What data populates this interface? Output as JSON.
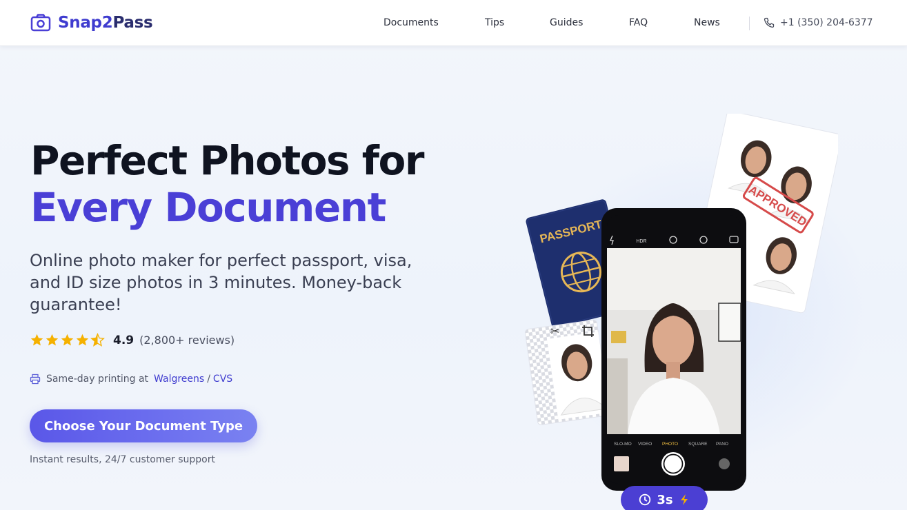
{
  "header": {
    "logo_text_a": "Snap2",
    "logo_text_b": "Pass",
    "logo_icon": "camera-icon",
    "nav": [
      "Documents",
      "Tips",
      "Guides",
      "FAQ",
      "News"
    ],
    "phone": "+1 (350) 204-6377",
    "phone_icon": "phone-icon"
  },
  "hero": {
    "title_line1": "Perfect Photos for",
    "title_line2": "Every Document",
    "subtitle": "Online photo maker for perfect passport, visa, and ID size photos in 3 minutes. Money-back guarantee!",
    "rating": {
      "score": "4.9",
      "reviews": "(2,800+ reviews)",
      "stars": 4.5
    },
    "printing": {
      "prefix": "Same-day printing at",
      "link1": "Walgreens",
      "sep": "/",
      "link2": "CVS"
    },
    "cta_label": "Choose Your Document Type",
    "cta_note": "Instant results, 24/7 customer support"
  },
  "illustration": {
    "passport_label": "PASSPORT",
    "stamp_label": "APPROVED",
    "camera_top": [
      "HDR"
    ],
    "camera_modes": [
      "SLO-MO",
      "VIDEO",
      "PHOTO",
      "SQUARE",
      "PANO"
    ],
    "timer_label": "3s"
  },
  "colors": {
    "brand": "#3f3ccf",
    "title_accent": "#4a3fd6",
    "star": "#f5b100",
    "timer_badge": "#4b3fd3"
  }
}
